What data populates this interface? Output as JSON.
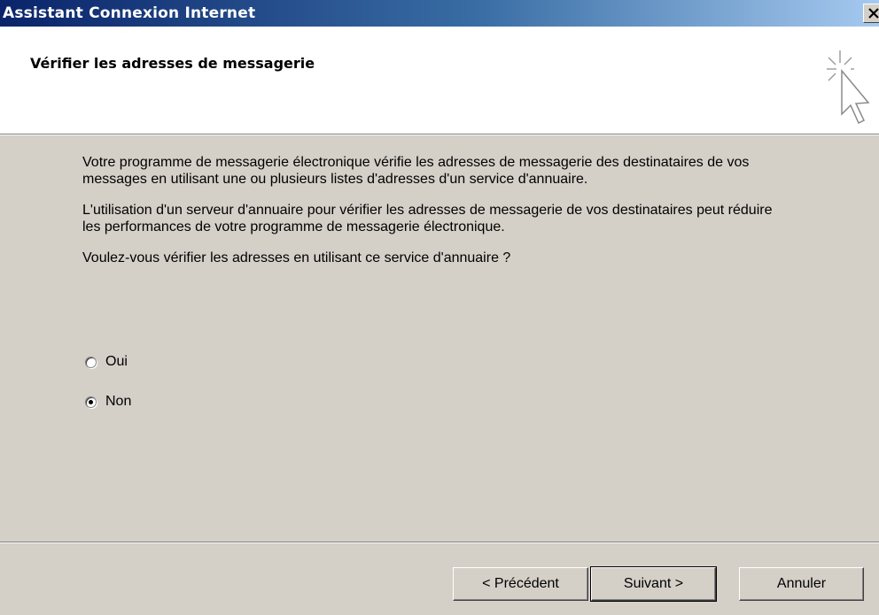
{
  "window": {
    "title": "Assistant Connexion Internet"
  },
  "header": {
    "title": "Vérifier les adresses de messagerie",
    "icon": "wizard-cursor-sparkle-icon"
  },
  "content": {
    "paragraph1": "Votre programme de messagerie électronique vérifie les adresses de messagerie des destinataires de vos messages en utilisant une ou plusieurs listes d'adresses d'un service d'annuaire.",
    "paragraph2": "L'utilisation d'un serveur d'annuaire pour vérifier les adresses de messagerie de vos destinataires peut réduire les performances de votre programme de messagerie électronique.",
    "question": "Voulez-vous vérifier les adresses en utilisant ce service d'annuaire ?"
  },
  "options": [
    {
      "label": "Oui",
      "checked": false
    },
    {
      "label": "Non",
      "checked": true
    }
  ],
  "buttons": {
    "back": "< Précédent",
    "next": "Suivant >",
    "cancel": "Annuler"
  }
}
